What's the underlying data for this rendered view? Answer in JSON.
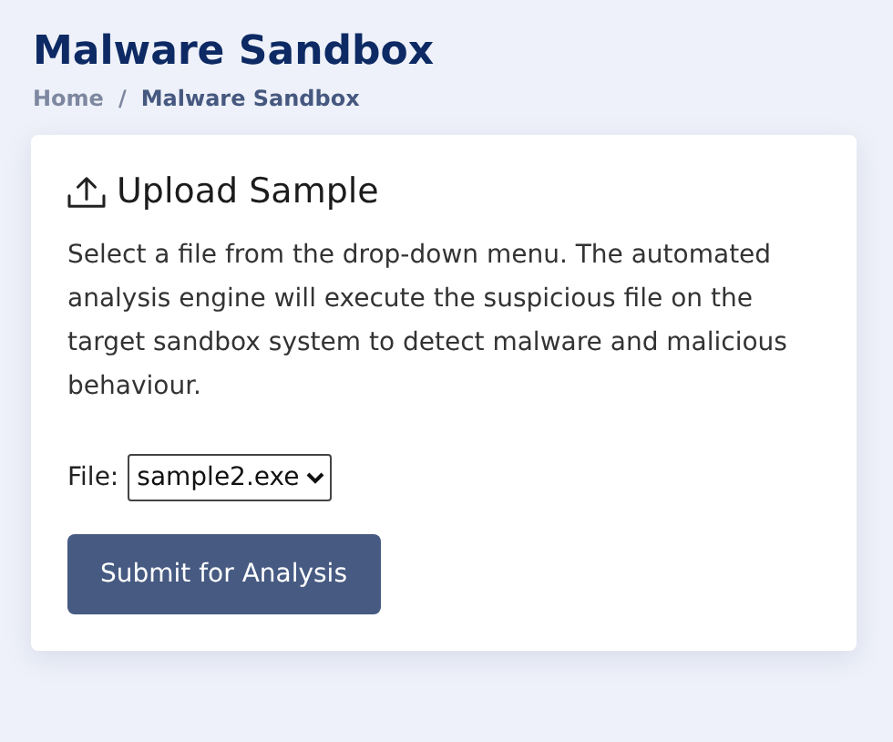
{
  "page_title": "Malware Sandbox",
  "breadcrumb": {
    "separator": "/",
    "items": [
      {
        "label": "Home",
        "current": false
      },
      {
        "label": "Malware Sandbox",
        "current": true
      }
    ]
  },
  "card": {
    "title": "Upload Sample",
    "description": "Select a file from the drop-down menu. The automated analysis engine will execute the suspicious file on the target sandbox system to detect malware and malicious behaviour.",
    "file_field": {
      "label": "File:",
      "value": "sample2.exe"
    },
    "submit_button": "Submit for Analysis"
  }
}
